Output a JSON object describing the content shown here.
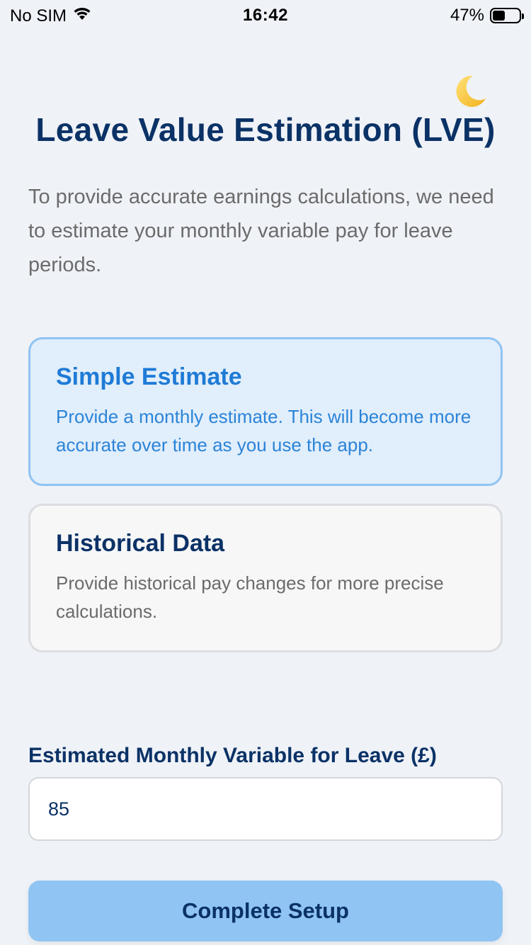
{
  "status_bar": {
    "carrier": "No SIM",
    "time": "16:42",
    "battery": "47%",
    "battery_level": 0.47
  },
  "header": {
    "theme_toggle_icon": "moon-icon",
    "title": "Leave Value Estimation (LVE)"
  },
  "intro_text": "To provide accurate earnings calculations, we need to estimate your monthly variable pay for leave periods.",
  "options": [
    {
      "title": "Simple Estimate",
      "description": "Provide a monthly estimate. This will become more accurate over time as you use the app.",
      "selected": true
    },
    {
      "title": "Historical Data",
      "description": "Provide historical pay changes for more precise calculations.",
      "selected": false
    }
  ],
  "estimate_field": {
    "label": "Estimated Monthly Variable for Leave (£)",
    "value": "85"
  },
  "complete_button": {
    "label": "Complete Setup"
  },
  "colors": {
    "background": "#eff2f7",
    "primary_dark": "#0b3266",
    "accent": "#1f7bd6",
    "selected_border": "#8fc4f3",
    "button": "#8fc4f3"
  }
}
